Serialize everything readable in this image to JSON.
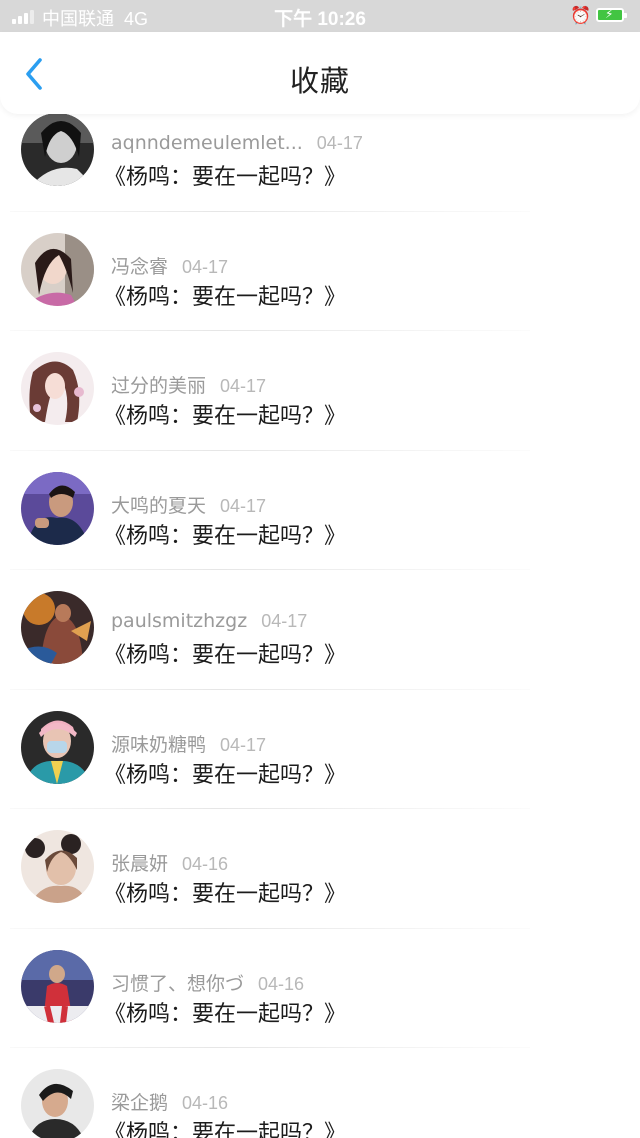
{
  "status_bar": {
    "carrier": "中国联通",
    "network": "4G",
    "time": "下午 10:26",
    "alarm_icon": "alarm-clock-icon",
    "battery_icon": "battery-charging-icon",
    "battery_color": "#42c542"
  },
  "header": {
    "title": "收藏",
    "back_icon": "chevron-left-icon",
    "accent_color": "#2b9ef0"
  },
  "favorites": [
    {
      "name": "aqnndemeulemlet...",
      "date": "04-17",
      "title": "《杨鸣：要在一起吗？》"
    },
    {
      "name": "冯念睿",
      "date": "04-17",
      "title": "《杨鸣：要在一起吗？》"
    },
    {
      "name": "过分的美丽",
      "date": "04-17",
      "title": "《杨鸣：要在一起吗？》"
    },
    {
      "name": "大鸣的夏天",
      "date": "04-17",
      "title": "《杨鸣：要在一起吗？》"
    },
    {
      "name": "paulsmitzhzgz",
      "date": "04-17",
      "title": "《杨鸣：要在一起吗？》"
    },
    {
      "name": "源味奶糖鸭",
      "date": "04-17",
      "title": "《杨鸣：要在一起吗？》"
    },
    {
      "name": "张晨妍",
      "date": "04-16",
      "title": "《杨鸣：要在一起吗？》"
    },
    {
      "name": "习惯了、想你づ",
      "date": "04-16",
      "title": "《杨鸣：要在一起吗？》"
    },
    {
      "name": "梁企鹅",
      "date": "04-16",
      "title": "《杨鸣：要在一起吗？》"
    }
  ]
}
